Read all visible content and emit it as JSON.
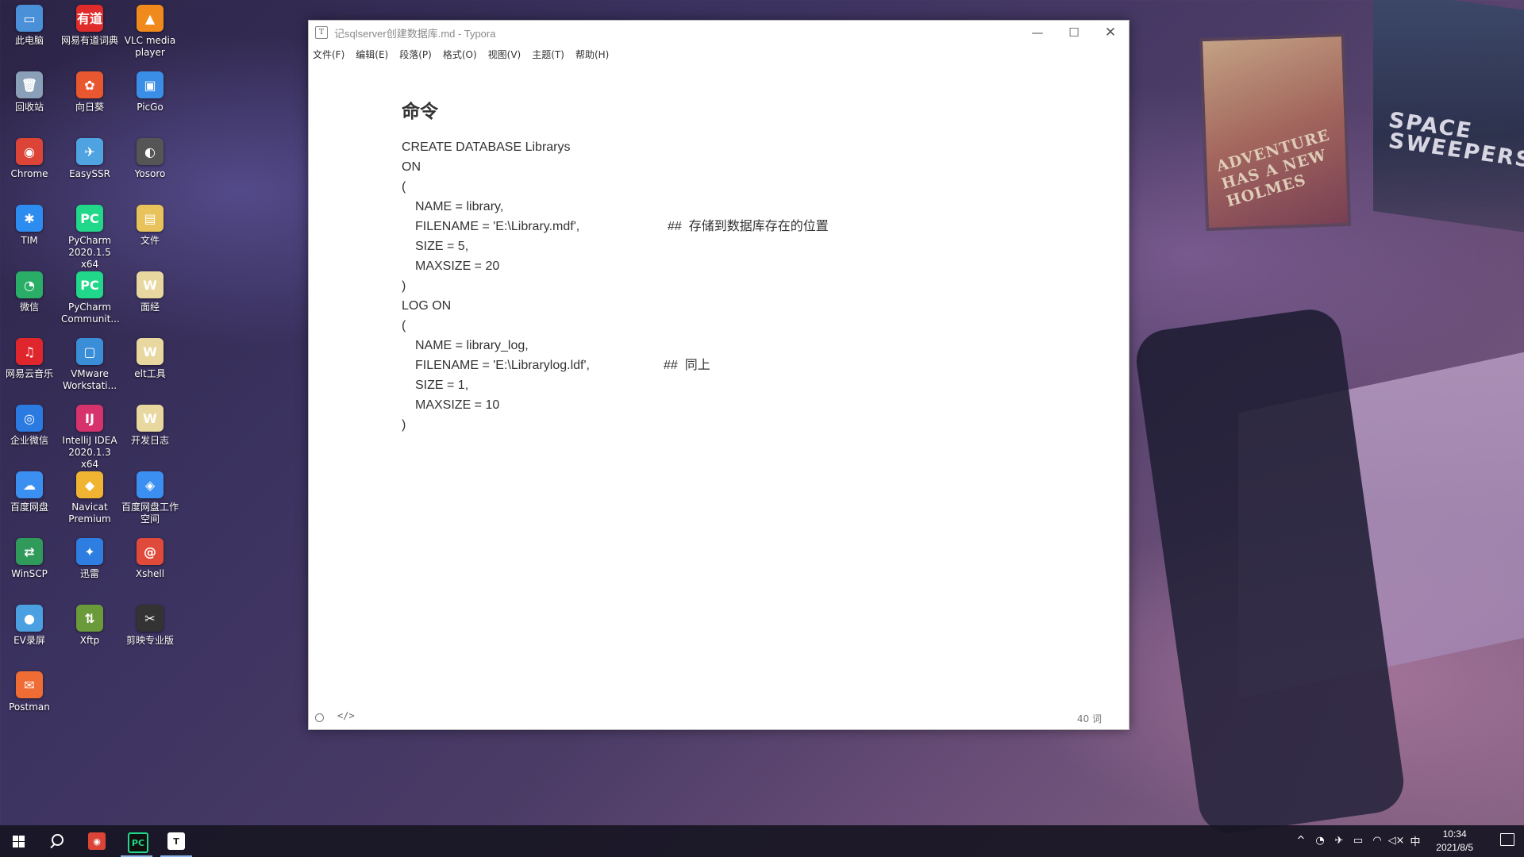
{
  "desktop": {
    "wallpaper_text": {
      "poster_left": "ADVENTURE HAS A NEW HOLMES",
      "poster_right": "SPACE SWEEPERS"
    },
    "icons": [
      {
        "label": "此电脑",
        "icon": "computer-icon",
        "color": "#4a90d9",
        "glyph": "▭"
      },
      {
        "label": "网易有道词典",
        "icon": "youdao-icon",
        "color": "#e02b2b",
        "glyph": "有道"
      },
      {
        "label": "VLC media player",
        "icon": "vlc-icon",
        "color": "#f08a1c",
        "glyph": "▲"
      },
      {
        "label": "回收站",
        "icon": "recycle-bin-icon",
        "color": "#8aa0b8",
        "glyph": "🗑"
      },
      {
        "label": "向日葵",
        "icon": "sunflower-icon",
        "color": "#e8572f",
        "glyph": "✿"
      },
      {
        "label": "PicGo",
        "icon": "picgo-icon",
        "color": "#3a8ee6",
        "glyph": "▣"
      },
      {
        "label": "Chrome",
        "icon": "chrome-icon",
        "color": "#db4437",
        "glyph": "◉"
      },
      {
        "label": "EasySSR",
        "icon": "easyssr-icon",
        "color": "#4fa3e0",
        "glyph": "✈"
      },
      {
        "label": "Yosoro",
        "icon": "yosoro-icon",
        "color": "#555555",
        "glyph": "◐"
      },
      {
        "label": "TIM",
        "icon": "tim-icon",
        "color": "#2d8cf0",
        "glyph": "✱"
      },
      {
        "label": "PyCharm 2020.1.5 x64",
        "icon": "pycharm-icon",
        "color": "#21d789",
        "glyph": "PC"
      },
      {
        "label": "文件",
        "icon": "folder-icon",
        "color": "#e8c25a",
        "glyph": "▤"
      },
      {
        "label": "微信",
        "icon": "wechat-icon",
        "color": "#2aae67",
        "glyph": "◔"
      },
      {
        "label": "PyCharm Communit...",
        "icon": "pycharm-community-icon",
        "color": "#21d789",
        "glyph": "PC"
      },
      {
        "label": "面经",
        "icon": "document-icon",
        "color": "#e8d8a0",
        "glyph": "W"
      },
      {
        "label": "网易云音乐",
        "icon": "netease-music-icon",
        "color": "#e0262d",
        "glyph": "♫"
      },
      {
        "label": "VMware Workstati...",
        "icon": "vmware-icon",
        "color": "#3a8ed8",
        "glyph": "▢"
      },
      {
        "label": "elt工具",
        "icon": "document-icon",
        "color": "#e8d8a0",
        "glyph": "W"
      },
      {
        "label": "企业微信",
        "icon": "wecom-icon",
        "color": "#2a7ae2",
        "glyph": "◎"
      },
      {
        "label": "IntelliJ IDEA 2020.1.3 x64",
        "icon": "intellij-icon",
        "color": "#d6336c",
        "glyph": "IJ"
      },
      {
        "label": "开发日志",
        "icon": "document-icon",
        "color": "#e8d8a0",
        "glyph": "W"
      },
      {
        "label": "百度网盘",
        "icon": "baidu-pan-icon",
        "color": "#3b8ff0",
        "glyph": "☁"
      },
      {
        "label": "Navicat Premium",
        "icon": "navicat-icon",
        "color": "#f0b432",
        "glyph": "◆"
      },
      {
        "label": "百度网盘工作空间",
        "icon": "baidu-workspace-icon",
        "color": "#3b8ff0",
        "glyph": "◈"
      },
      {
        "label": "WinSCP",
        "icon": "winscp-icon",
        "color": "#2f9a5a",
        "glyph": "⇄"
      },
      {
        "label": "迅雷",
        "icon": "xunlei-icon",
        "color": "#2d7ee0",
        "glyph": "✦"
      },
      {
        "label": "Xshell",
        "icon": "xshell-icon",
        "color": "#e04a3a",
        "glyph": "@"
      },
      {
        "label": "EV录屏",
        "icon": "ev-recorder-icon",
        "color": "#4aa0e0",
        "glyph": "●"
      },
      {
        "label": "Xftp",
        "icon": "xftp-icon",
        "color": "#6a9a3a",
        "glyph": "⇅"
      },
      {
        "label": "剪映专业版",
        "icon": "jianying-icon",
        "color": "#333333",
        "glyph": "✂"
      },
      {
        "label": "Postman",
        "icon": "postman-icon",
        "color": "#ef6c35",
        "glyph": "✉"
      }
    ]
  },
  "window": {
    "app_icon_letter": "T",
    "title": "记sqlserver创建数据库.md - Typora",
    "controls": {
      "minimize": "—",
      "maximize": "☐",
      "close": "✕"
    },
    "menu": [
      "文件(F)",
      "编辑(E)",
      "段落(P)",
      "格式(O)",
      "视图(V)",
      "主题(T)",
      "帮助(H)"
    ]
  },
  "document": {
    "heading": "命令",
    "lines": [
      {
        "text": "CREATE DATABASE Librarys",
        "comment": ""
      },
      {
        "text": "ON",
        "comment": ""
      },
      {
        "text": "(",
        "comment": ""
      },
      {
        "text": "NAME = library,",
        "comment": "",
        "indent": true
      },
      {
        "text": "FILENAME = 'E:\\Library.mdf',",
        "comment": "##  存储到数据库存在的位置",
        "indent": true
      },
      {
        "text": "SIZE = 5,",
        "comment": "",
        "indent": true
      },
      {
        "text": "MAXSIZE = 20",
        "comment": "",
        "indent": true
      },
      {
        "text": ")",
        "comment": ""
      },
      {
        "text": "LOG ON",
        "comment": ""
      },
      {
        "text": "(",
        "comment": ""
      },
      {
        "text": "NAME = library_log,",
        "comment": "",
        "indent": true
      },
      {
        "text": "FILENAME = 'E:\\Librarylog.ldf',",
        "comment": "##  同上",
        "indent": true
      },
      {
        "text": "SIZE = 1,",
        "comment": "",
        "indent": true
      },
      {
        "text": "MAXSIZE = 10",
        "comment": "",
        "indent": true
      },
      {
        "text": ")",
        "comment": ""
      }
    ]
  },
  "status_bar": {
    "source_mode_glyph": "</>",
    "word_count": "40 词"
  },
  "taskbar": {
    "apps": [
      {
        "name": "chrome",
        "icon": "chrome-icon",
        "color": "#db4437",
        "glyph": "◉",
        "running": false
      },
      {
        "name": "pycharm",
        "icon": "pycharm-icon",
        "color": "#21d789",
        "glyph": "PC",
        "running": true
      },
      {
        "name": "typora",
        "icon": "typora-icon",
        "color": "#ffffff",
        "glyph": "T",
        "running": true
      }
    ],
    "tray": [
      {
        "icon": "show-hidden-icons-chevron",
        "glyph": "^"
      },
      {
        "icon": "wechat-tray-icon",
        "glyph": "◔"
      },
      {
        "icon": "telegram-tray-icon",
        "glyph": "✈"
      },
      {
        "icon": "battery-icon",
        "glyph": "▭"
      },
      {
        "icon": "wifi-icon",
        "glyph": "◠"
      },
      {
        "icon": "volume-muted-icon",
        "glyph": "◁×"
      },
      {
        "icon": "input-method-icon",
        "glyph": "中"
      }
    ],
    "clock": {
      "time": "10:34",
      "date": "2021/8/5"
    }
  }
}
